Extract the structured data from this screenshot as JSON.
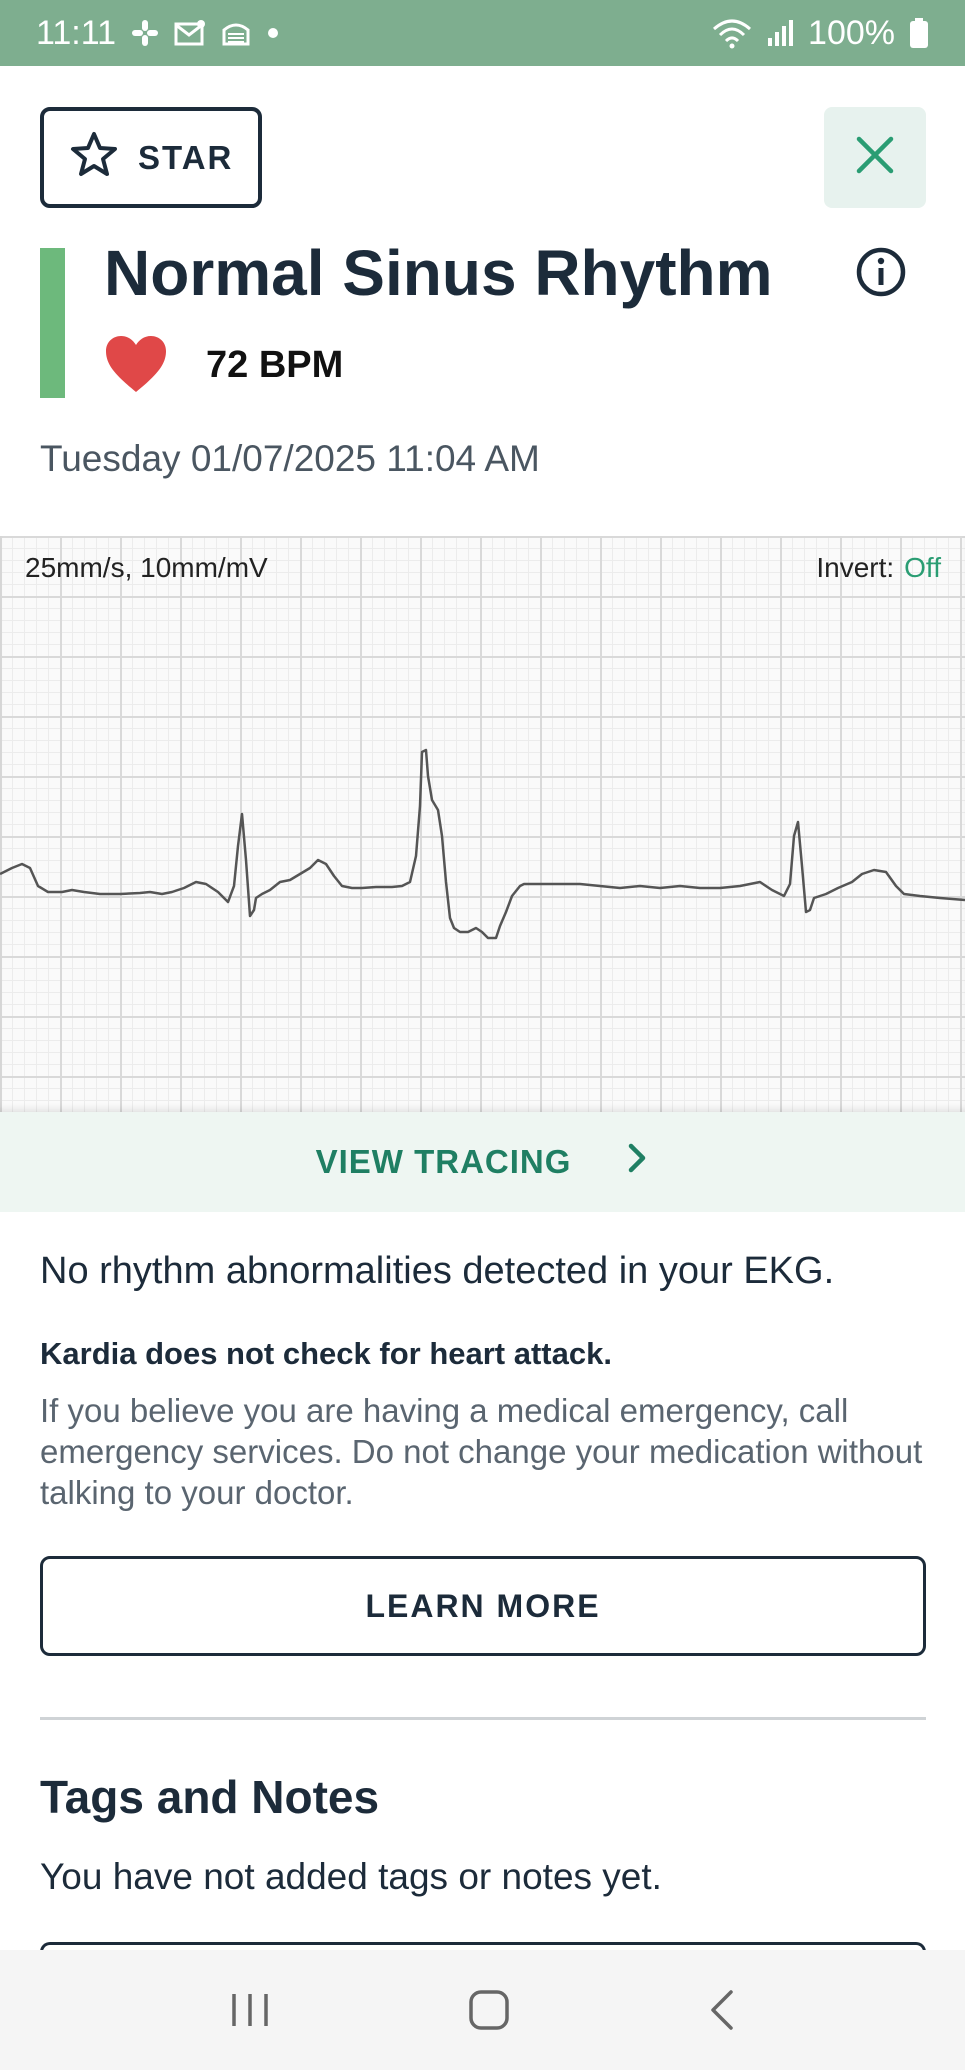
{
  "status_bar": {
    "time": "11:11",
    "battery": "100%",
    "icons": [
      "slack-icon",
      "mail-icon",
      "news-icon",
      "dot-icon",
      "wifi-icon",
      "signal-icon",
      "battery-icon"
    ]
  },
  "header": {
    "star_label": "STAR",
    "title": "Normal Sinus Rhythm",
    "heart_rate": "72 BPM",
    "date": "Tuesday 01/07/2025 11:04 AM",
    "accent_color": "#6db97c"
  },
  "ekg": {
    "scale": "25mm/s, 10mm/mV",
    "invert_label": "Invert:",
    "invert_value": "Off"
  },
  "view_tracing_label": "VIEW TRACING",
  "result": {
    "summary": "No rhythm abnormalities detected in your EKG.",
    "disclaimer_bold": "Kardia does not check for heart attack.",
    "advice": "If you believe you are having a medical emergency, call emergency services. Do not change your medication without talking to your doctor.",
    "learn_more_label": "LEARN MORE"
  },
  "tags": {
    "title": "Tags and Notes",
    "empty_text": "You have not added tags or notes yet."
  },
  "colors": {
    "status_bar": "#7eae8f",
    "primary_text": "#1c2b3a",
    "accent_green": "#1f7f63",
    "heart": "#e04848"
  }
}
